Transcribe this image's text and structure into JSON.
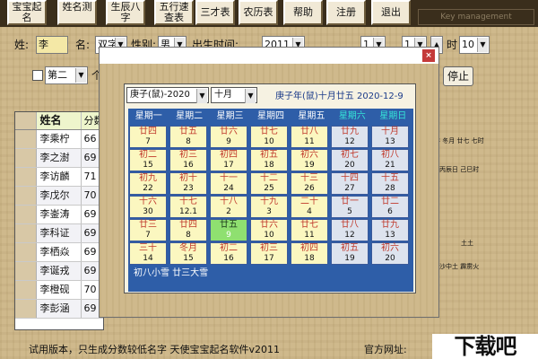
{
  "toolbar": {
    "buttons": [
      "宝宝起名",
      "姓名测",
      "生辰八字",
      "五行速查表",
      "三才表",
      "农历表",
      "帮助",
      "注册",
      "退出"
    ],
    "key_label": "Key management"
  },
  "form": {
    "surname_label": "姓:",
    "surname_value": "李",
    "name_label": "名:",
    "name_value": "双字",
    "gender_label": "性别:",
    "gender_value": "男",
    "birth_label": "出生时间:",
    "year_value": "2011",
    "month_value": "1",
    "day_value": "1",
    "hour_value": "10",
    "hour_unit": "时",
    "char_pos_value": "第二",
    "char_pos_suffix": "个",
    "stop_label": "停止"
  },
  "name_table": {
    "headers": [
      "姓名",
      "分数"
    ],
    "rows": [
      {
        "name": "李乘柠",
        "score": "66"
      },
      {
        "name": "李之澍",
        "score": "69"
      },
      {
        "name": "李访麟",
        "score": "71"
      },
      {
        "name": "李戊尔",
        "score": "70"
      },
      {
        "name": "李崟涛",
        "score": "69"
      },
      {
        "name": "李科证",
        "score": "69"
      },
      {
        "name": "李栖焱",
        "score": "69"
      },
      {
        "name": "李诞戎",
        "score": "69"
      },
      {
        "name": "李橙砚",
        "score": "70"
      },
      {
        "name": "李彭涵",
        "score": "69"
      }
    ]
  },
  "right_panel": {
    "line1": "年 冬月 廿七 七时",
    "line2": "丙辰日  己巳时",
    "line3": "土土",
    "line4": "沙中土  霹雳火"
  },
  "status": {
    "trial_text": "试用版本，只生成分数较低名字 天使宝宝起名软件v2011",
    "site_label": "官方网址:"
  },
  "watermark": "下载吧",
  "calendar": {
    "year_select": "庚子(鼠)-2020",
    "month_select": "十月",
    "lunar_date": "庚子年(鼠)十月廿五  2020-12-9",
    "weekdays": [
      "星期一",
      "星期二",
      "星期三",
      "星期四",
      "星期五",
      "星期六",
      "星期日"
    ],
    "weeks": [
      [
        [
          "廿四",
          "7"
        ],
        [
          "廿五",
          "8"
        ],
        [
          "廿六",
          "9"
        ],
        [
          "廿七",
          "10"
        ],
        [
          "廿八",
          "11"
        ],
        [
          "廿九",
          "12"
        ],
        [
          "十月",
          "13"
        ]
      ],
      [
        [
          "初二",
          "15"
        ],
        [
          "初三",
          "16"
        ],
        [
          "初四",
          "17"
        ],
        [
          "初五",
          "18"
        ],
        [
          "初六",
          "19"
        ],
        [
          "初七",
          "20"
        ],
        [
          "初八",
          "21"
        ]
      ],
      [
        [
          "初九",
          "22"
        ],
        [
          "初十",
          "23"
        ],
        [
          "十一",
          "24"
        ],
        [
          "十二",
          "25"
        ],
        [
          "十三",
          "26"
        ],
        [
          "十四",
          "27"
        ],
        [
          "十五",
          "28"
        ]
      ],
      [
        [
          "十六",
          "30"
        ],
        [
          "十七",
          "12.1"
        ],
        [
          "十八",
          "2"
        ],
        [
          "十九",
          "3"
        ],
        [
          "二十",
          "4"
        ],
        [
          "廿一",
          "5"
        ],
        [
          "廿二",
          "6"
        ]
      ],
      [
        [
          "廿三",
          "7"
        ],
        [
          "廿四",
          "8"
        ],
        [
          "廿五",
          "9"
        ],
        [
          "廿六",
          "10"
        ],
        [
          "廿七",
          "11"
        ],
        [
          "廿八",
          "12"
        ],
        [
          "廿九",
          "13"
        ]
      ],
      [
        [
          "三十",
          "14"
        ],
        [
          "冬月",
          "15"
        ],
        [
          "初二",
          "16"
        ],
        [
          "初三",
          "17"
        ],
        [
          "初四",
          "18"
        ],
        [
          "初五",
          "19"
        ],
        [
          "初六",
          "20"
        ]
      ]
    ],
    "today_index": [
      4,
      2
    ],
    "solar_terms": "初八小雪  廿三大雪"
  },
  "colors": {
    "lunar_text": "#c0392b",
    "grid_blue": "#2e5ea8",
    "today_green": "#8fe070",
    "weekend_header": "#35e5d8"
  }
}
